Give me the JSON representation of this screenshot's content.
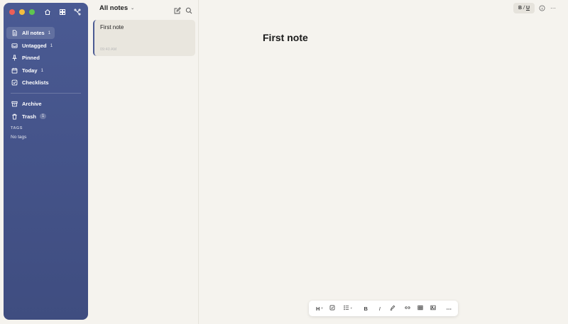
{
  "sidebar": {
    "items": [
      {
        "label": "All notes",
        "count": "1",
        "icon": "document-icon"
      },
      {
        "label": "Untagged",
        "count": "1",
        "icon": "inbox-icon"
      },
      {
        "label": "Pinned",
        "count": "",
        "icon": "pin-icon"
      },
      {
        "label": "Today",
        "count": "1",
        "icon": "calendar-icon"
      },
      {
        "label": "Checklists",
        "count": "",
        "icon": "checkbox-icon"
      }
    ],
    "secondary_items": [
      {
        "label": "Archive",
        "count": "",
        "icon": "archive-icon"
      },
      {
        "label": "Trash",
        "count": "1",
        "icon": "trash-icon"
      }
    ],
    "tags_label": "TAGS",
    "no_tags": "No tags",
    "accent": "#4a5a93"
  },
  "list": {
    "header": "All notes",
    "notes": [
      {
        "title": "First note",
        "time": "09:40 AM"
      }
    ]
  },
  "editor": {
    "title": "First note",
    "format_button": {
      "b": "B",
      "sep1": "/",
      "i": "I",
      "sep2": "/",
      "u": "U"
    },
    "more_icon": "⋯"
  },
  "toolbar": {
    "heading_label": "H",
    "bold_label": "B",
    "italic_label": "I",
    "more_label": "⋯"
  }
}
